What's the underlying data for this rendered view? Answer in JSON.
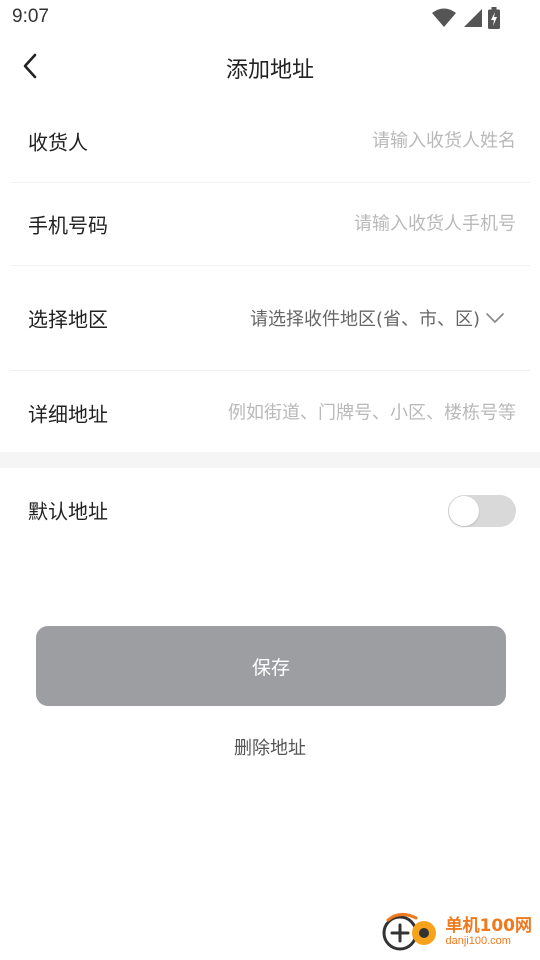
{
  "status_bar": {
    "time": "9:07",
    "icons": [
      "wifi-icon",
      "signal-icon",
      "battery-charging-icon"
    ]
  },
  "header": {
    "title": "添加地址"
  },
  "form": {
    "recipient": {
      "label": "收货人",
      "placeholder": "请输入收货人姓名",
      "value": ""
    },
    "phone": {
      "label": "手机号码",
      "placeholder": "请输入收货人手机号",
      "value": ""
    },
    "region": {
      "label": "选择地区",
      "value": "请选择收件地区(省、市、区)"
    },
    "address": {
      "label": "详细地址",
      "placeholder": "例如街道、门牌号、小区、楼栋号等",
      "value": ""
    }
  },
  "default_address": {
    "label": "默认地址",
    "enabled": false
  },
  "actions": {
    "save_label": "保存",
    "delete_label": "删除地址"
  },
  "watermark": {
    "cn": "单机100网",
    "en": "danji100.com"
  },
  "colors": {
    "save_button": "#9c9ea1",
    "toggle_off": "#d9d9d9",
    "placeholder": "#b9b9b9",
    "watermark": "#ef7a1e"
  }
}
